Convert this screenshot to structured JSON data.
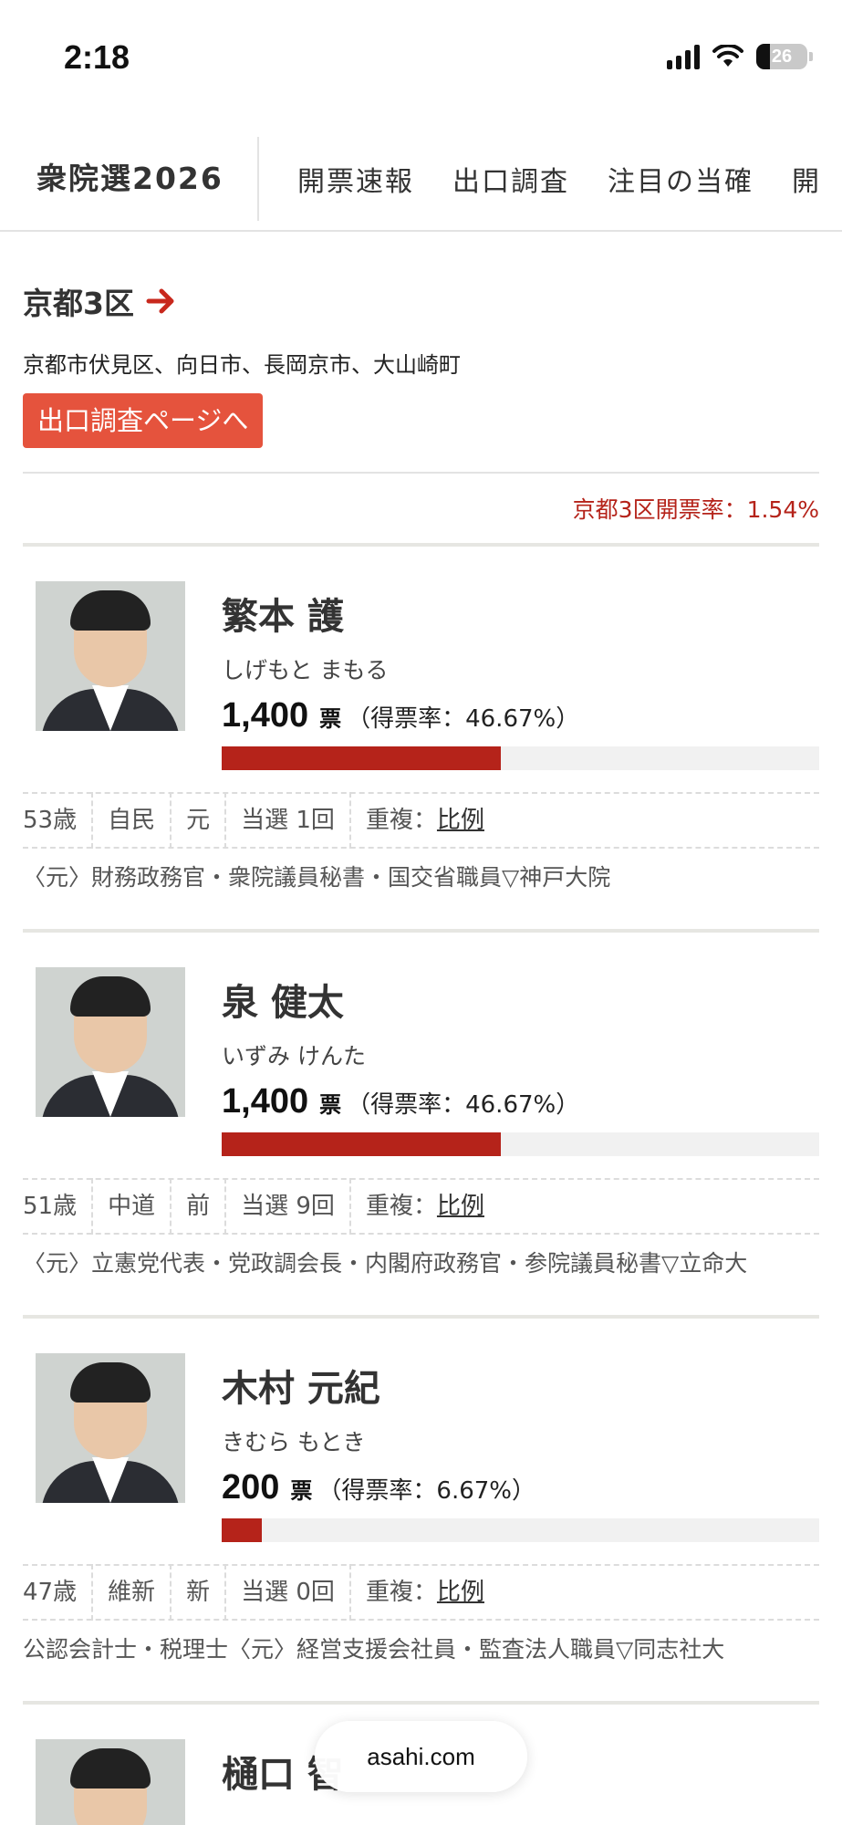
{
  "status": {
    "time": "2:18",
    "battery": "26"
  },
  "nav": {
    "brand": "衆院選2026",
    "tabs": [
      "開票速報",
      "出口調査",
      "注目の当確",
      "開"
    ]
  },
  "district": {
    "title": "京都3区",
    "areas": "京都市伏見区、向日市、長岡京市、大山崎町",
    "exit_poll_button": "出口調査ページへ",
    "count_rate": "京都3区開票率：1.54%"
  },
  "candidates": [
    {
      "name": "繁本 護",
      "kana": "しげもと まもる",
      "votes": "1,400",
      "unit": "票",
      "share_text": "（得票率：46.67%）",
      "share": 46.67,
      "age": "53歳",
      "party": "自民",
      "status": "元",
      "wins": "当選 1回",
      "dup_label": "重複：",
      "dup_link": "比例",
      "career": "〈元〉財務政務官・衆院議員秘書・国交省職員▽神戸大院"
    },
    {
      "name": "泉 健太",
      "kana": "いずみ けんた",
      "votes": "1,400",
      "unit": "票",
      "share_text": "（得票率：46.67%）",
      "share": 46.67,
      "age": "51歳",
      "party": "中道",
      "status": "前",
      "wins": "当選 9回",
      "dup_label": "重複：",
      "dup_link": "比例",
      "career": "〈元〉立憲党代表・党政調会長・内閣府政務官・参院議員秘書▽立命大"
    },
    {
      "name": "木村 元紀",
      "kana": "きむら もとき",
      "votes": "200",
      "unit": "票",
      "share_text": "（得票率：6.67%）",
      "share": 6.67,
      "age": "47歳",
      "party": "維新",
      "status": "新",
      "wins": "当選 0回",
      "dup_label": "重複：",
      "dup_link": "比例",
      "career": "公認会計士・税理士〈元〉経営支援会社員・監査法人職員▽同志社大"
    },
    {
      "name": "樋口 智"
    }
  ],
  "footer": {
    "site": "asahi.com"
  },
  "colors": {
    "accent": "#b5231a",
    "button": "#e5533d"
  }
}
